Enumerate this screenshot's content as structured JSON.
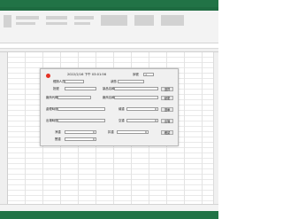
{
  "dialog": {
    "datetime": "2022/2/16 下午 03:01:56",
    "serial_label": "序號",
    "serial_value": "1",
    "operator_label": "經辦人員",
    "status_label": "狀態",
    "batch_label": "批號",
    "product_name_label": "製品名稱",
    "select_button": "選擇",
    "machine_code_label": "廠商代碼",
    "vendor_name_label": "廠商名稱",
    "modify_button": "變更",
    "process_time_label": "處理時間",
    "weight_label": "總重",
    "weight_value": "0",
    "confirm_button": "選單",
    "exit_time_label": "出場時間",
    "empty_weight_label": "空重",
    "empty_weight_value": "0",
    "exit_button": "出場",
    "net_weight_label": "淨重",
    "net_weight_value": "0",
    "discount_label": "扣重",
    "discount_value": "0",
    "ok_button": "確認",
    "actual_label": "實重",
    "actual_value": "0"
  },
  "colors": {
    "excel_green": "#217346",
    "record_dot": "#e53224"
  }
}
